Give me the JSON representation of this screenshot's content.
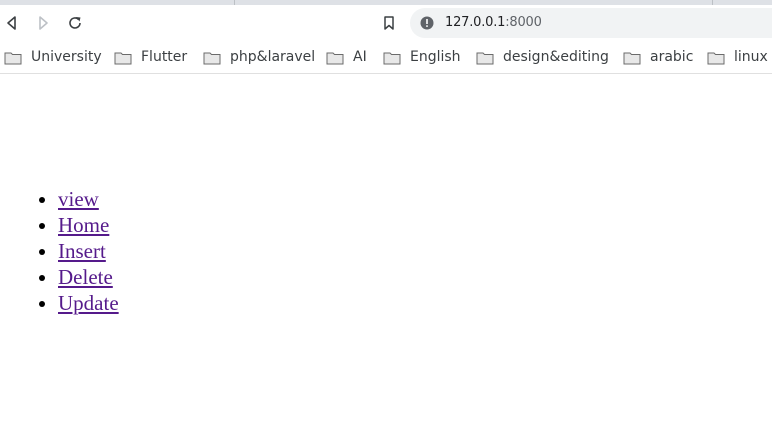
{
  "browser": {
    "url_host": "127.0.0.1",
    "url_port": ":8000"
  },
  "bookmarks": [
    {
      "label": "University"
    },
    {
      "label": "Flutter"
    },
    {
      "label": "php&laravel"
    },
    {
      "label": "AI"
    },
    {
      "label": "English"
    },
    {
      "label": "design&editing"
    },
    {
      "label": "arabic"
    },
    {
      "label": "linux"
    }
  ],
  "page": {
    "links": [
      {
        "label": "view"
      },
      {
        "label": "Home"
      },
      {
        "label": "Insert"
      },
      {
        "label": "Delete"
      },
      {
        "label": "Update"
      }
    ]
  }
}
